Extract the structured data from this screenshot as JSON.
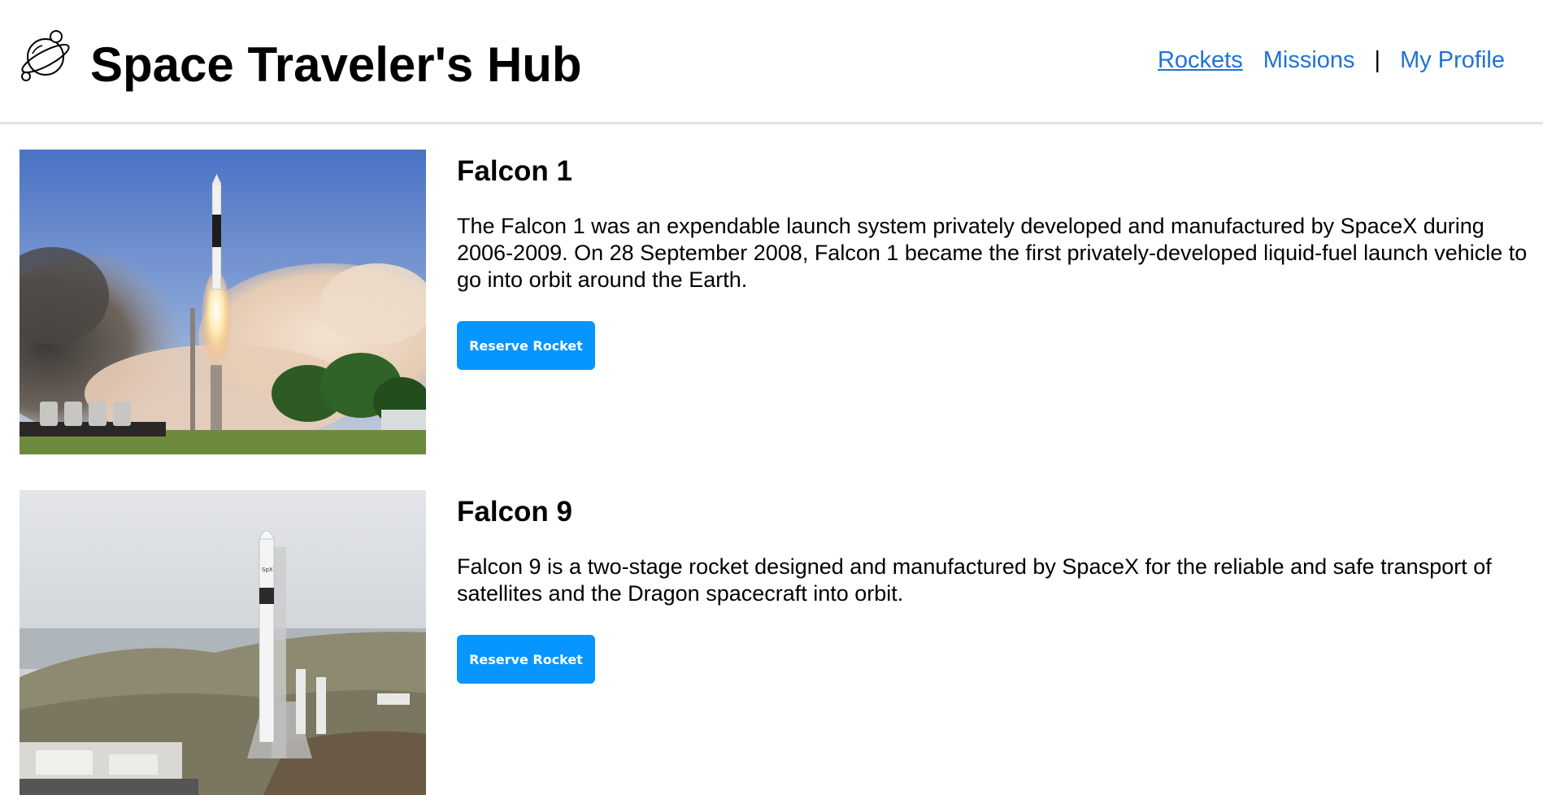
{
  "header": {
    "title": "Space Traveler's Hub",
    "logo_icon": "planet-icon"
  },
  "nav": {
    "links": [
      {
        "label": "Rockets",
        "active": true
      },
      {
        "label": "Missions",
        "active": false
      },
      {
        "label": "My Profile",
        "active": false
      }
    ],
    "separator": "|"
  },
  "rockets": [
    {
      "name": "Falcon 1",
      "description": "The Falcon 1 was an expendable launch system privately developed and manufactured by SpaceX during 2006-2009. On 28 September 2008, Falcon 1 became the first privately-developed liquid-fuel launch vehicle to go into orbit around the Earth.",
      "button_label": "Reserve Rocket",
      "image": "falcon-1-launch-photo"
    },
    {
      "name": "Falcon 9",
      "description": "Falcon 9 is a two-stage rocket designed and manufactured by SpaceX for the reliable and safe transport of satellites and the Dragon spacecraft into orbit.",
      "button_label": "Reserve Rocket",
      "image": "falcon-9-launchpad-photo"
    }
  ],
  "colors": {
    "link": "#1e72d8",
    "button": "#0795ff",
    "divider": "#e2e2e2"
  }
}
